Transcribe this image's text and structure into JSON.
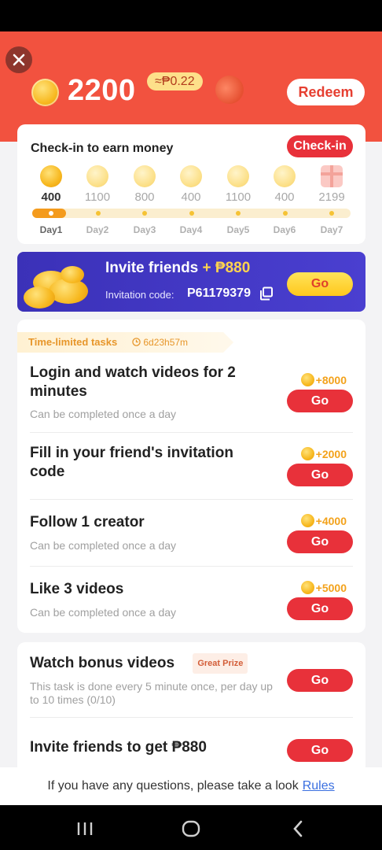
{
  "header": {
    "close_label": "close",
    "balance": "2200",
    "approx_value": "≈₱0.22",
    "redeem_label": "Redeem"
  },
  "checkin": {
    "title": "Check-in to earn money",
    "button_label": "Check-in",
    "progress_days_completed": 1,
    "days": [
      {
        "amount": "400",
        "label": "Day1",
        "active": true,
        "icon": "coin-icon"
      },
      {
        "amount": "1100",
        "label": "Day2",
        "active": false,
        "icon": "coin-icon"
      },
      {
        "amount": "800",
        "label": "Day3",
        "active": false,
        "icon": "coin-icon"
      },
      {
        "amount": "400",
        "label": "Day4",
        "active": false,
        "icon": "coin-icon"
      },
      {
        "amount": "1100",
        "label": "Day5",
        "active": false,
        "icon": "coin-icon"
      },
      {
        "amount": "400",
        "label": "Day6",
        "active": false,
        "icon": "coin-icon"
      },
      {
        "amount": "2199",
        "label": "Day7",
        "active": false,
        "icon": "gift-icon"
      }
    ]
  },
  "invite_banner": {
    "title": "Invite friends",
    "reward": "+ ₱880",
    "code_label": "Invitation code:",
    "code": "P61179379",
    "go_label": "Go"
  },
  "time_limited": {
    "label": "Time-limited tasks",
    "timer": "6d23h57m"
  },
  "tasks": [
    {
      "title": "Login and watch videos for 2 minutes",
      "subtitle": "Can be completed once a day",
      "reward": "+8000",
      "go_label": "Go"
    },
    {
      "title": "Fill in your friend's invitation code",
      "subtitle": "",
      "reward": "+2000",
      "go_label": "Go"
    },
    {
      "title": "Follow 1 creator",
      "subtitle": "Can be completed once a day",
      "reward": "+4000",
      "go_label": "Go"
    },
    {
      "title": "Like 3 videos",
      "subtitle": "Can be completed once a day",
      "reward": "+5000",
      "go_label": "Go"
    }
  ],
  "tasks2": [
    {
      "title": "Watch bonus videos",
      "badge": "Great Prize",
      "subtitle": "This task is done every 5 minute once, per day up to 10 times (0/10)",
      "go_label": "Go"
    },
    {
      "title": "Invite friends to get ₱880",
      "go_label": "Go"
    }
  ],
  "footer": {
    "text": "If you have any questions, please take a look",
    "rules_label": "Rules"
  },
  "colors": {
    "header_red": "#f2523f",
    "action_red": "#e8313a",
    "coin_gold": "#f7b81f",
    "invite_purple": "#3b31b8"
  }
}
